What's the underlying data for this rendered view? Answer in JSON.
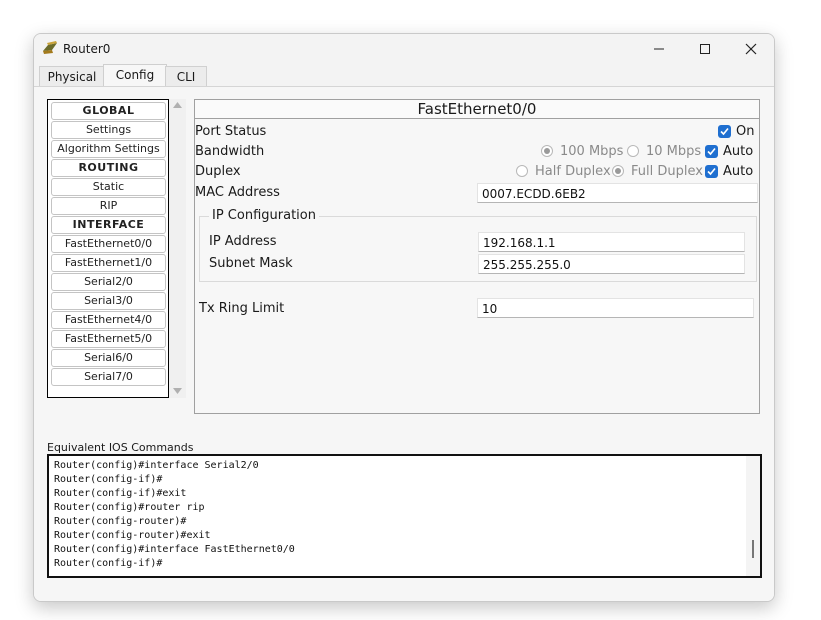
{
  "window": {
    "title": "Router0",
    "controls": {
      "minimize": "minimize-icon",
      "maximize": "maximize-icon",
      "close": "close-icon"
    }
  },
  "tabs": [
    {
      "label": "Physical",
      "active": false
    },
    {
      "label": "Config",
      "active": true
    },
    {
      "label": "CLI",
      "active": false
    }
  ],
  "sidebar": {
    "items": [
      {
        "label": "GLOBAL",
        "header": true
      },
      {
        "label": "Settings"
      },
      {
        "label": "Algorithm Settings"
      },
      {
        "label": "ROUTING",
        "header": true
      },
      {
        "label": "Static"
      },
      {
        "label": "RIP"
      },
      {
        "label": "INTERFACE",
        "header": true
      },
      {
        "label": "FastEthernet0/0"
      },
      {
        "label": "FastEthernet1/0"
      },
      {
        "label": "Serial2/0"
      },
      {
        "label": "Serial3/0"
      },
      {
        "label": "FastEthernet4/0"
      },
      {
        "label": "FastEthernet5/0"
      },
      {
        "label": "Serial6/0"
      },
      {
        "label": "Serial7/0"
      }
    ]
  },
  "panel": {
    "title": "FastEthernet0/0",
    "port_status": {
      "label": "Port Status",
      "on_label": "On",
      "checked": true
    },
    "bandwidth": {
      "label": "Bandwidth",
      "opt1": "100 Mbps",
      "opt2": "10 Mbps",
      "auto_label": "Auto",
      "auto_checked": true,
      "selected": "100 Mbps"
    },
    "duplex": {
      "label": "Duplex",
      "opt1": "Half Duplex",
      "opt2": "Full Duplex",
      "auto_label": "Auto",
      "auto_checked": true,
      "selected": "Full Duplex"
    },
    "mac": {
      "label": "MAC Address",
      "value": "0007.ECDD.6EB2"
    },
    "ip_config": {
      "title": "IP Configuration",
      "ip_label": "IP Address",
      "ip_value": "192.168.1.1",
      "mask_label": "Subnet Mask",
      "mask_value": "255.255.255.0"
    },
    "tx_ring": {
      "label": "Tx Ring Limit",
      "value": "10"
    }
  },
  "ios": {
    "label": "Equivalent IOS Commands",
    "lines": [
      "Router(config)#interface Serial2/0",
      "Router(config-if)#",
      "Router(config-if)#exit",
      "Router(config)#router rip",
      "Router(config-router)#",
      "Router(config-router)#exit",
      "Router(config)#interface FastEthernet0/0",
      "Router(config-if)#"
    ]
  },
  "colors": {
    "accent": "#1f6fd0",
    "window_bg": "#f3f3f3",
    "border": "#a0a0a0"
  }
}
